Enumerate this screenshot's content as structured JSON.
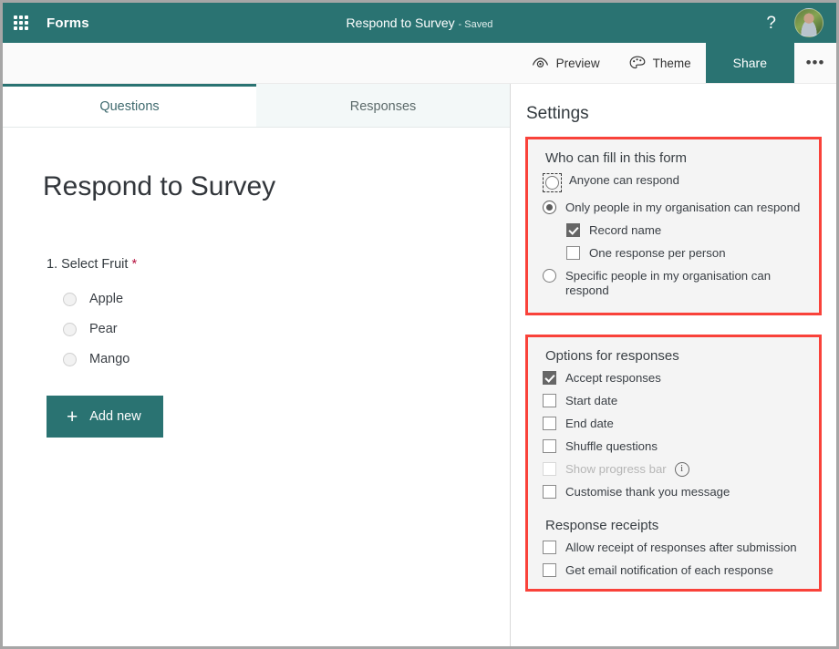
{
  "titlebar": {
    "app_launcher": "app-launcher",
    "brand": "Forms",
    "doc_title": "Respond to Survey",
    "saved_label": "- Saved",
    "help": "?",
    "avatar": "user-avatar"
  },
  "commandbar": {
    "preview": "Preview",
    "theme": "Theme",
    "share": "Share",
    "more": "•••"
  },
  "tabs": [
    {
      "label": "Questions",
      "active": true
    },
    {
      "label": "Responses",
      "active": false
    }
  ],
  "form": {
    "title": "Respond to Survey",
    "question": {
      "number": "1.",
      "text": "Select Fruit",
      "required_marker": "*",
      "choices": [
        "Apple",
        "Pear",
        "Mango"
      ]
    },
    "add_new": "Add new",
    "add_new_plus": "+"
  },
  "settings": {
    "title": "Settings",
    "who_can_fill": {
      "heading": "Who can fill in this form",
      "options": [
        {
          "label": "Anyone can respond",
          "type": "radio",
          "selected": false,
          "focused": true
        },
        {
          "label": "Only people in my organisation can respond",
          "type": "radio",
          "selected": true
        },
        {
          "label": "Record name",
          "type": "checkbox",
          "checked": true,
          "indent": true
        },
        {
          "label": "One response per person",
          "type": "checkbox",
          "checked": false,
          "indent": true
        },
        {
          "label": "Specific people in my organisation can respond",
          "type": "radio",
          "selected": false
        }
      ]
    },
    "options_for_responses": {
      "heading": "Options for responses",
      "options": [
        {
          "label": "Accept responses",
          "checked": true,
          "disabled": false
        },
        {
          "label": "Start date",
          "checked": false,
          "disabled": false
        },
        {
          "label": "End date",
          "checked": false,
          "disabled": false
        },
        {
          "label": "Shuffle questions",
          "checked": false,
          "disabled": false
        },
        {
          "label": "Show progress bar",
          "checked": false,
          "disabled": true,
          "info": true,
          "info_glyph": "i"
        },
        {
          "label": "Customise thank you message",
          "checked": false,
          "disabled": false
        }
      ]
    },
    "response_receipts": {
      "heading": "Response receipts",
      "options": [
        {
          "label": "Allow receipt of responses after submission",
          "checked": false
        },
        {
          "label": "Get email notification of each response",
          "checked": false
        }
      ]
    }
  },
  "colors": {
    "brand_teal": "#2a7372",
    "highlight_red": "#f9423a",
    "required_star": "#b5123f"
  }
}
